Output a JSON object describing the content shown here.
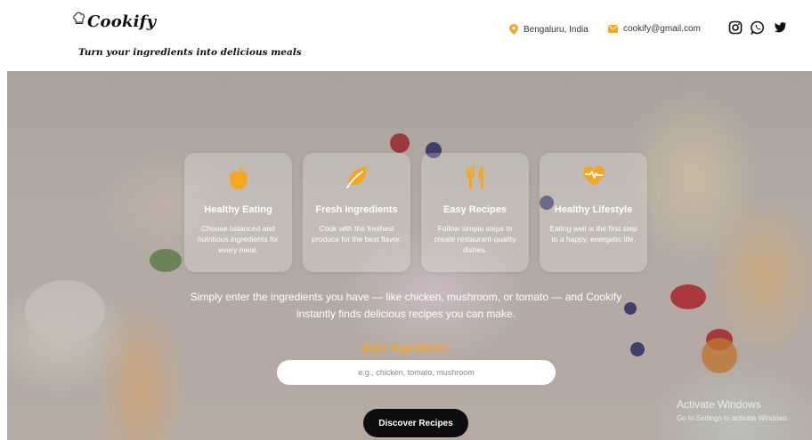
{
  "header": {
    "brand_name": "Cookify",
    "tagline": "Turn your ingredients into delicious meals",
    "location": "Bengaluru, India",
    "email": "cookify@gmail.com",
    "socials": [
      "instagram-icon",
      "whatsapp-icon",
      "twitter-icon"
    ]
  },
  "colors": {
    "accent": "#f5a623",
    "button": "#0d0d0d",
    "text_dark": "#111111"
  },
  "features": [
    {
      "icon": "apple-icon",
      "title": "Healthy Eating",
      "desc": "Choose balanced and nutritious ingredients for every meal."
    },
    {
      "icon": "leaf-icon",
      "title": "Fresh Ingredients",
      "desc": "Cook with the freshest produce for the best flavor."
    },
    {
      "icon": "utensils-icon",
      "title": "Easy Recipes",
      "desc": "Follow simple steps to create restaurant-quality dishes."
    },
    {
      "icon": "heartbeat-icon",
      "title": "Healthy Lifestyle",
      "desc": "Eating well is the first step to a happy, energetic life."
    }
  ],
  "intro": "Simply enter the ingredients you have — like chicken, mushroom, or tomato — and Cookify instantly finds delicious recipes you can make.",
  "search": {
    "label": "Enter Ingredients:",
    "placeholder": "e.g., chicken, tomato, mushroom",
    "value": "",
    "button": "Discover Recipes"
  },
  "watermark": {
    "title": "Activate Windows",
    "subtitle": "Go to Settings to activate Windows."
  }
}
